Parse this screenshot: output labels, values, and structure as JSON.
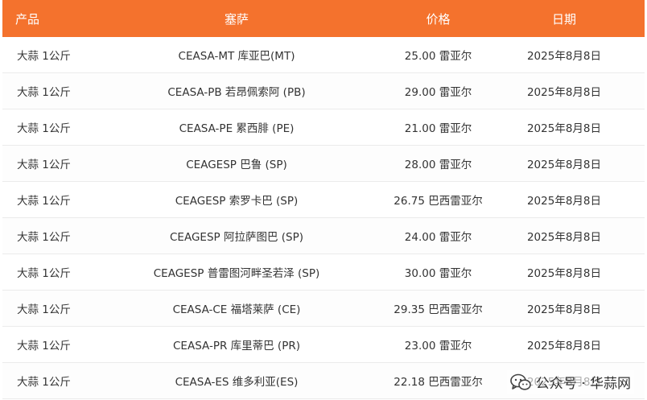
{
  "table": {
    "headers": {
      "product": "产品",
      "market": "塞萨",
      "price": "价格",
      "date": "日期"
    },
    "rows": [
      {
        "product": "大蒜 1公斤",
        "market": "CEASA-MT 库亚巴(MT)",
        "price": "25.00 雷亚尔",
        "date": "2025年8月8日"
      },
      {
        "product": "大蒜 1公斤",
        "market": "CEASA-PB 若昂佩索阿 (PB)",
        "price": "29.00 雷亚尔",
        "date": "2025年8月8日"
      },
      {
        "product": "大蒜 1公斤",
        "market": "CEASA-PE 累西腓 (PE)",
        "price": "21.00 雷亚尔",
        "date": "2025年8月8日"
      },
      {
        "product": "大蒜 1公斤",
        "market": "CEAGESP 巴鲁 (SP)",
        "price": "28.00 雷亚尔",
        "date": "2025年8月8日"
      },
      {
        "product": "大蒜 1公斤",
        "market": "CEAGESP 索罗卡巴 (SP)",
        "price": "26.75 巴西雷亚尔",
        "date": "2025年8月8日"
      },
      {
        "product": "大蒜 1公斤",
        "market": "CEAGESP 阿拉萨图巴 (SP)",
        "price": "24.00 雷亚尔",
        "date": "2025年8月8日"
      },
      {
        "product": "大蒜 1公斤",
        "market": "CEAGESP 普雷图河畔圣若泽 (SP)",
        "price": "30.00 雷亚尔",
        "date": "2025年8月8日"
      },
      {
        "product": "大蒜 1公斤",
        "market": "CEASA-CE 福塔莱萨 (CE)",
        "price": "29.35 巴西雷亚尔",
        "date": "2025年8月8日"
      },
      {
        "product": "大蒜 1公斤",
        "market": "CEASA-PR 库里蒂巴 (PR)",
        "price": "23.00 雷亚尔",
        "date": "2025年8月8日"
      },
      {
        "product": "大蒜 1公斤",
        "market": "CEASA-ES 维多利亚(ES)",
        "price": "22.18 巴西雷亚尔",
        "date": "2025年8月8日"
      }
    ]
  },
  "watermark": {
    "text": "公众号 · 华蒜网",
    "icon": "wechat-icon"
  },
  "colors": {
    "header_bg": "#f4722d",
    "header_text": "#ffffff",
    "row_text": "#333333",
    "row_border": "#ebebeb"
  }
}
